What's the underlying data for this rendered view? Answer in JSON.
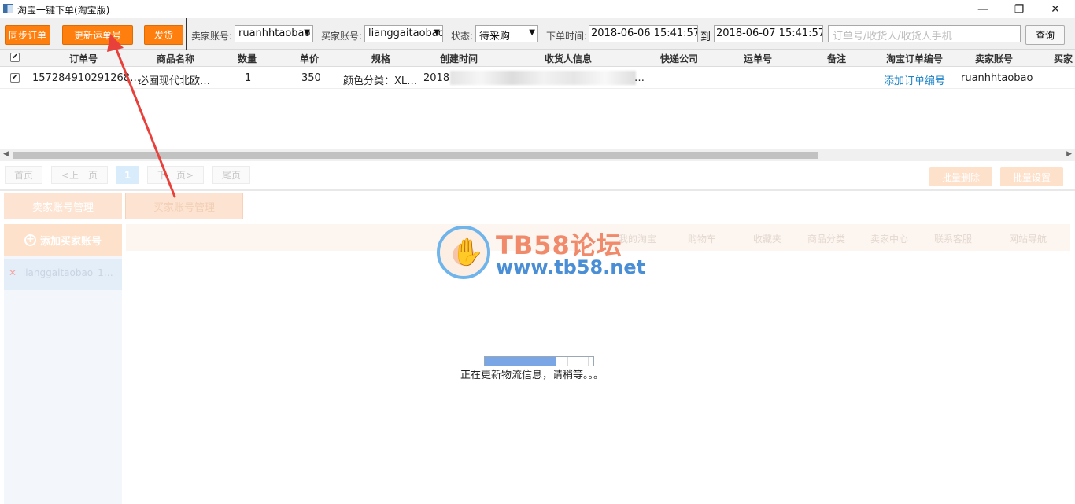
{
  "window": {
    "title": "淘宝一键下单(淘宝版)",
    "minimize_glyph": "—",
    "maximize_glyph": "❐",
    "close_glyph": "✕"
  },
  "toolbar": {
    "sync_orders": "同步订单",
    "update_tracking": "更新运单号",
    "ship": "发货",
    "seller_label": "卖家账号:",
    "seller_value": "ruanhhtaobao",
    "buyer_label": "买家账号:",
    "buyer_value": "lianggaitaobao",
    "status_label": "状态:",
    "status_value": "待采购",
    "order_time_label": "下单时间:",
    "date_from": "2018-06-06 15:41:57",
    "to_label": "到",
    "date_to": "2018-06-07 15:41:57",
    "search_placeholder": "订单号/收货人/收货人手机",
    "query": "查询"
  },
  "table": {
    "headers": [
      "订单号",
      "商品名称",
      "数量",
      "单价",
      "规格",
      "创建时间",
      "收货人信息",
      "快递公司",
      "运单号",
      "备注",
      "淘宝订单编号",
      "卖家账号",
      "买家"
    ],
    "rows": [
      {
        "order_no": "157284910291268…",
        "product": "必囿现代北欧…",
        "qty": "1",
        "price": "350",
        "spec": "颜色分类：XL…",
        "created": "2018",
        "receiver_tail": "…",
        "taobao_order": "添加订单编号",
        "seller": "ruanhhtaobao"
      }
    ],
    "check_glyph": "✔"
  },
  "pager": {
    "first": "首页",
    "prev": "<上一页",
    "page": "1",
    "next": "下一页>",
    "last": "尾页",
    "batch_delete": "批量删除",
    "batch_settings": "批量设置"
  },
  "tabs": {
    "seller_mgmt": "卖家账号管理",
    "buyer_mgmt": "买家账号管理"
  },
  "accounts": {
    "add": "添加买家账号",
    "items": [
      "lianggaitaobao_1…"
    ],
    "remove_glyph": "✕"
  },
  "browser_nav": [
    "我的淘宝",
    "购物车",
    "收藏夹",
    "商品分类",
    "卖家中心",
    "联系客服",
    "网站导航"
  ],
  "watermark": {
    "title": "TB58论坛",
    "url": "www.tb58.net"
  },
  "progress": {
    "fraction": 0.65,
    "text": "正在更新物流信息，请稍等。。。"
  },
  "colors": {
    "accent_orange": "#ff7f0e",
    "link_blue": "#1a82c8",
    "arrow_red": "#e8403a"
  }
}
